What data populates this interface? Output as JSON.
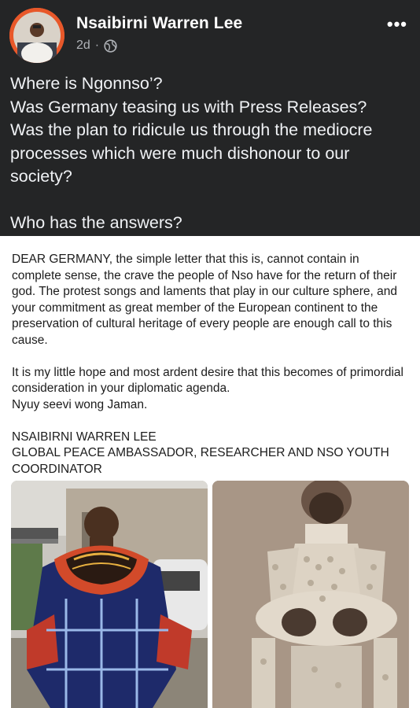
{
  "post": {
    "author": "Nsaibirni Warren Lee",
    "time": "2d",
    "separator": "·",
    "more_label": "•••",
    "caption_lines": [
      "Where is Ngonnso’?",
      "Was Germany teasing us with Press Releases?",
      "Was the plan to ridicule us through the mediocre processes which were much dishonour to our society?",
      "",
      "Who has the answers?"
    ]
  },
  "letter": {
    "paragraph_1": "DEAR GERMANY, the simple letter that this is, cannot contain in complete sense, the crave the people of Nso have for the return of their god. The protest songs and laments that play in our culture sphere, and your commitment as great member of the European continent to the preservation of cultural heritage of every people are enough call to this cause.",
    "paragraph_2": "It is my little hope and most ardent desire that this becomes of primordial consideration in your diplomatic agenda.",
    "paragraph_3": "Nyuy seevi wong Jaman.",
    "signature_name": "NSAIBIRNI WARREN LEE",
    "signature_title": "GLOBAL PEACE AMBASSADOR, RESEARCHER AND NSO YOUTH COORDINATOR"
  },
  "icons": {
    "avatar": "avatar-photo",
    "audience": "globe-icon",
    "more": "more-options-icon"
  },
  "colors": {
    "header_bg": "#242526",
    "avatar_ring": "#e8582a",
    "meta_text": "#b0b3b8"
  }
}
